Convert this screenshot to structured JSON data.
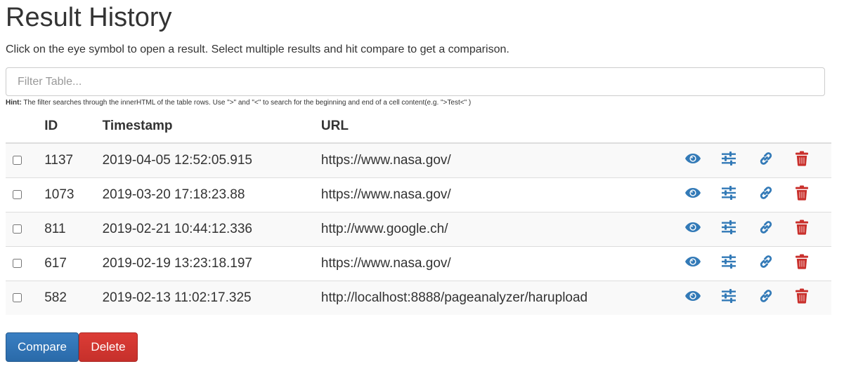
{
  "page": {
    "title": "Result History",
    "subtitle": "Click on the eye symbol to open a result. Select multiple results and hit compare to get a comparison."
  },
  "filter": {
    "placeholder": "Filter Table...",
    "value": ""
  },
  "hint": {
    "label": "Hint:",
    "text": "The filter searches through the innerHTML of the table rows. Use \">\" and \"<\" to search for the beginning and end of a cell content(e.g. \">Test<\" )"
  },
  "table": {
    "headers": [
      "",
      "ID",
      "Timestamp",
      "URL"
    ],
    "rows": [
      {
        "id": "1137",
        "timestamp": "2019-04-05 12:52:05.915",
        "url": "https://www.nasa.gov/"
      },
      {
        "id": "1073",
        "timestamp": "2019-03-20 17:18:23.88",
        "url": "https://www.nasa.gov/"
      },
      {
        "id": "811",
        "timestamp": "2019-02-21 10:44:12.336",
        "url": "http://www.google.ch/"
      },
      {
        "id": "617",
        "timestamp": "2019-02-19 13:23:18.197",
        "url": "https://www.nasa.gov/"
      },
      {
        "id": "582",
        "timestamp": "2019-02-13 11:02:17.325",
        "url": "http://localhost:8888/pageanalyzer/harupload"
      }
    ],
    "row_icons": [
      "eye-icon",
      "sliders-icon",
      "link-icon",
      "trash-icon"
    ]
  },
  "buttons": {
    "compare_label": "Compare",
    "delete_label": "Delete"
  },
  "colors": {
    "icon_blue": "#337ab7",
    "icon_red": "#c9302c",
    "compare": "#337ab7",
    "delete": "#d9534f"
  }
}
